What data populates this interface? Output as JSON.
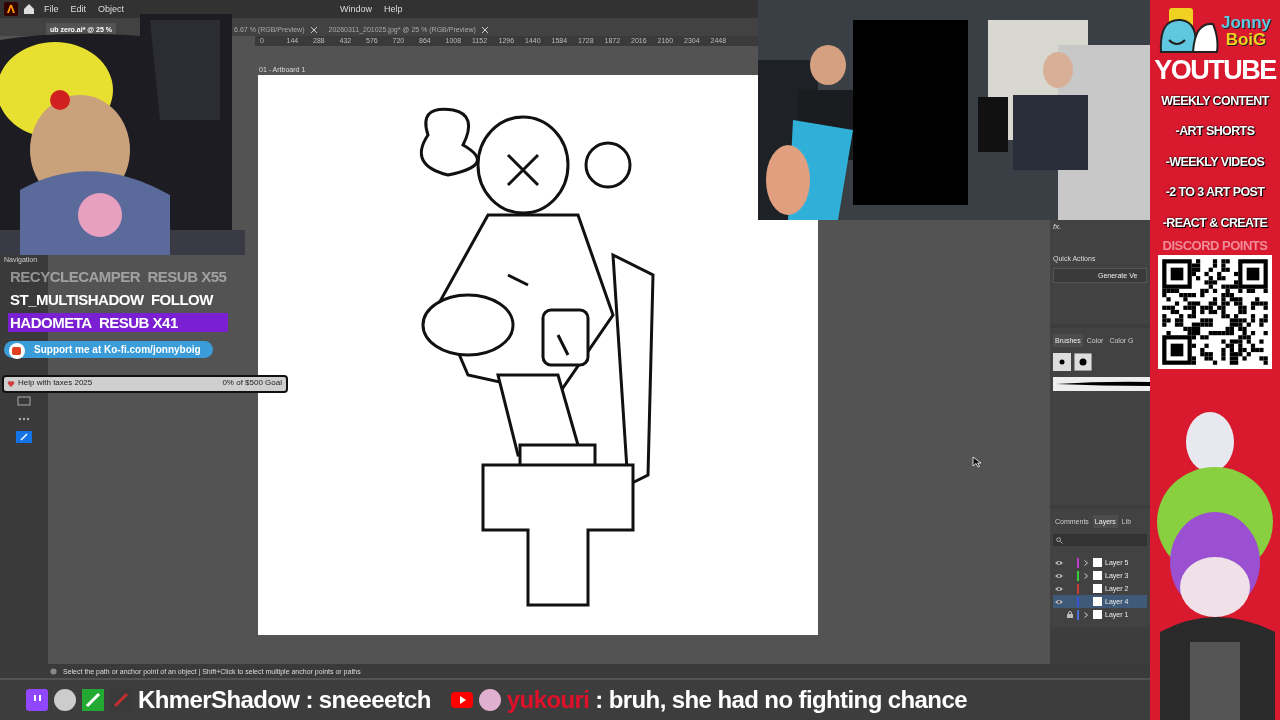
{
  "app": {
    "menu": [
      "File",
      "Edit",
      "Object",
      "Window",
      "Help"
    ],
    "tabs": [
      {
        "label": "ub zero.ai* @ 25 %",
        "selected": true
      },
      {
        "label": "6.67 % (RGB/Preview)",
        "selected": false
      },
      {
        "label": "20260311_201025.jpg* @ 25 % (RGB/Preview)",
        "selected": false
      }
    ],
    "ruler": [
      "0",
      "144",
      "288",
      "432",
      "576",
      "720",
      "864",
      "1008",
      "1152",
      "1296",
      "1440",
      "1584",
      "1728",
      "1872",
      "2016",
      "2160",
      "2304",
      "2448"
    ],
    "navigation_label": "Navigation",
    "artboard_label": "01 - Artboard 1",
    "properties": {
      "fx": "fx.",
      "quick_actions": "Quick Actions",
      "generate_button": "Generate Ve"
    },
    "brushes_tabs": [
      {
        "label": "Brushes",
        "selected": true
      },
      {
        "label": "Color",
        "selected": false
      },
      {
        "label": "Color G",
        "selected": false
      }
    ],
    "layers_tabs": [
      {
        "label": "Comments",
        "selected": false
      },
      {
        "label": "Layers",
        "selected": true
      },
      {
        "label": "Lib",
        "selected": false
      }
    ],
    "layers": [
      {
        "name": "Layer 5",
        "color": "#c03ccc",
        "visible": true,
        "locked": false,
        "has_sublayers": true,
        "selected": false
      },
      {
        "name": "Layer 3",
        "color": "#3ccc3c",
        "visible": true,
        "locked": false,
        "has_sublayers": true,
        "selected": false
      },
      {
        "name": "Layer 2",
        "color": "#cc3c3c",
        "visible": true,
        "locked": false,
        "has_sublayers": false,
        "selected": false
      },
      {
        "name": "Layer 4",
        "color": "#3c50dc",
        "visible": true,
        "locked": false,
        "has_sublayers": false,
        "selected": true
      },
      {
        "name": "Layer 1",
        "color": "#4a6ad8",
        "visible": false,
        "locked": true,
        "has_sublayers": true,
        "selected": false
      }
    ],
    "status": "Select the path or anchor point of an object  |  Shift+Click to select multiple anchor points or paths"
  },
  "alerts": [
    {
      "user": "RECYCLECAMPER",
      "event": "RESUB X55",
      "highlighted": false,
      "faded": true
    },
    {
      "user": "ST_MULTISHADOW",
      "event": "FOLLOW",
      "highlighted": false,
      "faded": false
    },
    {
      "user": "HADOMETA",
      "event": "RESUB X41",
      "highlighted": true,
      "faded": false
    }
  ],
  "kofi": "Support me at Ko-fi.com/jonnyboig",
  "goal": {
    "title": "Help with taxes 2025",
    "progress": "0% of $500 Goal",
    "level": 0
  },
  "chat": [
    {
      "kind": "twitch",
      "user": "KhmerShadow",
      "color": "#ffffff",
      "separator": ":",
      "message": "sneeeetch"
    },
    {
      "kind": "youtube",
      "user": "yukouri",
      "color": "#e0102a",
      "separator": ":",
      "message": "bruh, she had no fighting chance"
    }
  ],
  "banner": {
    "logo_top": "Jonny",
    "logo_bottom": "BoiG",
    "title": "YOUTUBE",
    "lines": [
      "WEEKLY CONTENT",
      "-ART SHORTS",
      "-WEEKLY VIDEOS",
      "-2 TO 3 ART POST",
      "-REACT & CREATE"
    ],
    "faded": "DISCORD POINTS"
  }
}
